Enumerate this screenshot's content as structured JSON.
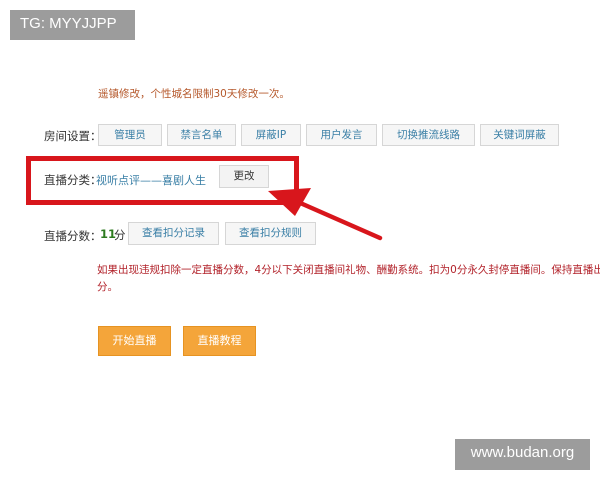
{
  "watermarks": {
    "top_left": "TG: MYYJJPP",
    "bottom_right": "www.budan.org"
  },
  "notice_top": "遥镇修改，个性城名限制30天修改一次。",
  "room_settings": {
    "label": "房间设置：",
    "buttons": [
      "管理员",
      "禁言名单",
      "屏蔽IP",
      "用户发言",
      "切换推流线路",
      "关键词屏蔽"
    ]
  },
  "category": {
    "label": "直播分类：",
    "value": "视听点评——喜剧人生",
    "change_label": "更改"
  },
  "score": {
    "label": "直播分数：",
    "value": "11",
    "unit": "分",
    "buttons": [
      "查看扣分记录",
      "查看扣分规则"
    ]
  },
  "notice_red": {
    "line1": "如果出现违规扣除一定直播分数，4分以下关闭直播间礼物、酬勤系统。扣为0分永久封停直播间。保持直播出勤",
    "line2": "分。"
  },
  "actions": {
    "start_label": "开始直播",
    "tutorial_label": "直播教程"
  },
  "colors": {
    "highlight": "#d8161c",
    "orange_button": "#f4a53a",
    "link_blue": "#3a7fa6",
    "notice_red": "#b2222a"
  }
}
